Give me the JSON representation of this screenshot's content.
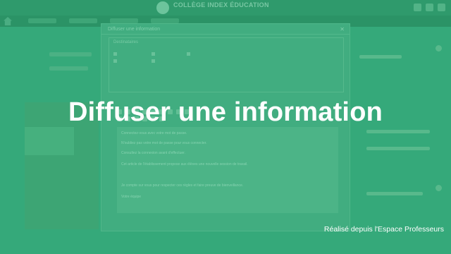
{
  "overlay": {
    "headline": "Diffuser une information",
    "caption": "Réalisé depuis l'Espace Professeurs"
  },
  "background": {
    "school_name": "COLLÈGE INDEX ÉDUCATION",
    "dialog_title": "Diffuser une information",
    "recipients_label": "Destinataires",
    "editor_lines": [
      "Connectez-vous avec votre mot de passe.",
      "N'oubliez pas votre mot de passe pour vous connecter.",
      "Consultez la connexion avant d'effectuer.",
      "Cet article de l'établissement propose aux élèves une nouvelle session de travail.",
      "Je compte sur vous pour respecter ces règles et faire preuve de bienveillance.",
      "Votre équipe"
    ]
  },
  "colors": {
    "overlay_green": "#2a9d6e",
    "text": "#ffffff"
  }
}
